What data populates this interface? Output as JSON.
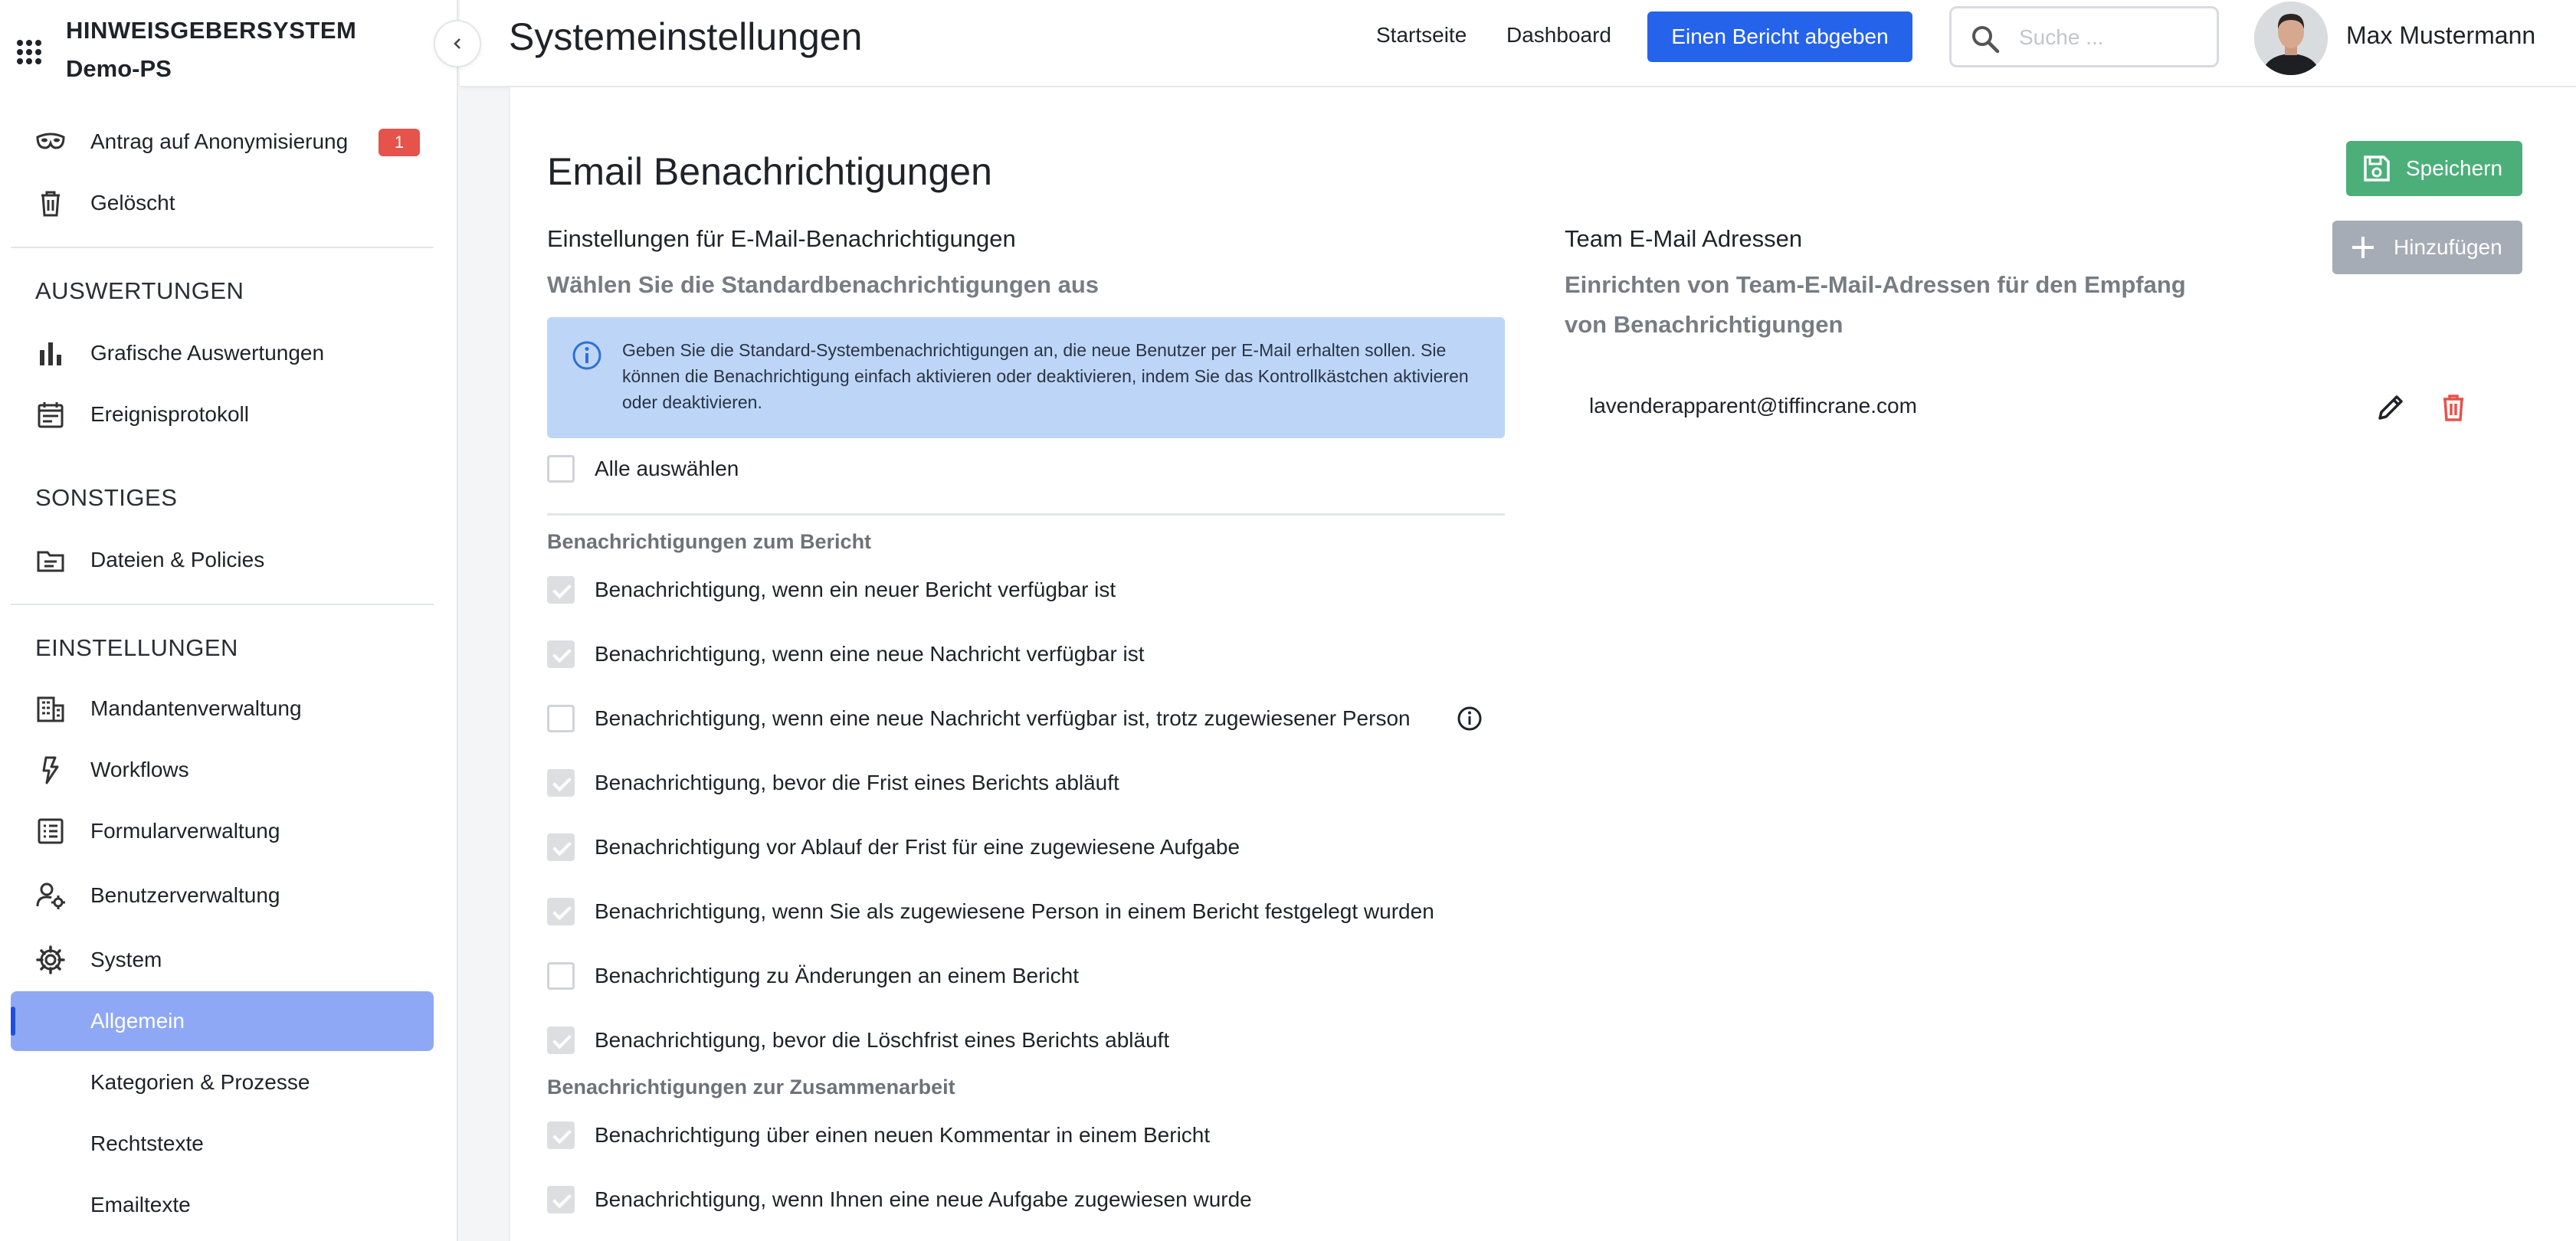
{
  "sidebar": {
    "brand_title": "HINWEISGEBERSYSTEM",
    "brand_sub": "Demo-PS",
    "items_top": [
      {
        "label": "Antrag auf Anonymisierung",
        "badge": "1",
        "icon": "mask-icon"
      },
      {
        "label": "Gelöscht",
        "icon": "trash-icon"
      }
    ],
    "section_auswertungen": "AUSWERTUNGEN",
    "items_auswertungen": [
      {
        "label": "Grafische Auswertungen",
        "icon": "bar-chart-icon"
      },
      {
        "label": "Ereignisprotokoll",
        "icon": "calendar-icon"
      }
    ],
    "section_sonstiges": "SONSTIGES",
    "items_sonstiges": [
      {
        "label": "Dateien & Policies",
        "icon": "folder-icon"
      }
    ],
    "section_einstellungen": "EINSTELLUNGEN",
    "items_einstellungen": [
      {
        "label": "Mandantenverwaltung",
        "icon": "building-icon"
      },
      {
        "label": "Workflows",
        "icon": "lightning-icon"
      },
      {
        "label": "Formularverwaltung",
        "icon": "list-icon"
      },
      {
        "label": "Benutzerverwaltung",
        "icon": "user-gear-icon"
      },
      {
        "label": "System",
        "icon": "gear-icon"
      }
    ],
    "items_system": [
      {
        "label": "Allgemein",
        "active": true
      },
      {
        "label": "Kategorien & Prozesse"
      },
      {
        "label": "Rechtstexte"
      },
      {
        "label": "Emailtexte"
      }
    ]
  },
  "header": {
    "title": "Systemeinstellungen",
    "links": [
      "Startseite",
      "Dashboard"
    ],
    "cta": "Einen Bericht abgeben",
    "search_placeholder": "Suche ...",
    "user_name": "Max Mustermann"
  },
  "main": {
    "title": "Email Benachrichtigungen",
    "save_label": "Speichern",
    "left": {
      "heading": "Einstellungen für E-Mail-Benachrichtigungen",
      "subheading": "Wählen Sie die Standardbenachrichtigungen aus",
      "info": "Geben Sie die Standard-Systembenachrichtigungen an, die neue Benutzer per E-Mail erhalten sollen. Sie können die Benachrichtigung einfach aktivieren oder deaktivieren, indem Sie das Kontrollkästchen aktivieren oder deaktivieren.",
      "select_all": "Alle auswählen",
      "group_report": "Benachrichtigungen zum Bericht",
      "report_items": [
        {
          "label": "Benachrichtigung, wenn ein neuer Bericht verfügbar ist",
          "checked": true
        },
        {
          "label": "Benachrichtigung, wenn eine neue Nachricht verfügbar ist",
          "checked": true
        },
        {
          "label": "Benachrichtigung, wenn eine neue Nachricht verfügbar ist, trotz zugewiesener Person",
          "checked": false,
          "info": true
        },
        {
          "label": "Benachrichtigung, bevor die Frist eines Berichts abläuft",
          "checked": true
        },
        {
          "label": "Benachrichtigung vor Ablauf der Frist für eine zugewiesene Aufgabe",
          "checked": true
        },
        {
          "label": "Benachrichtigung, wenn Sie als zugewiesene Person in einem Bericht festgelegt wurden",
          "checked": true
        },
        {
          "label": "Benachrichtigung zu Änderungen an einem Bericht",
          "checked": false
        },
        {
          "label": "Benachrichtigung, bevor die Löschfrist eines Berichts abläuft",
          "checked": true
        }
      ],
      "group_collab": "Benachrichtigungen zur Zusammenarbeit",
      "collab_items": [
        {
          "label": "Benachrichtigung über einen neuen Kommentar in einem Bericht",
          "checked": true
        },
        {
          "label": "Benachrichtigung, wenn Ihnen eine neue Aufgabe zugewiesen wurde",
          "checked": true
        }
      ]
    },
    "right": {
      "heading": "Team E-Mail Adressen",
      "subheading_1": "Einrichten von Team-E-Mail-Adressen für den Empfang",
      "subheading_2": "von Benachrichtigungen",
      "add_label": "Hinzufügen",
      "emails": [
        "lavenderapparent@tiffincrane.com"
      ]
    }
  },
  "colors": {
    "primary": "#2563eb",
    "success": "#4caf7a",
    "danger": "#e5534b",
    "active_nav": "#8ea8f6",
    "info_bg": "#bdd6f8"
  }
}
